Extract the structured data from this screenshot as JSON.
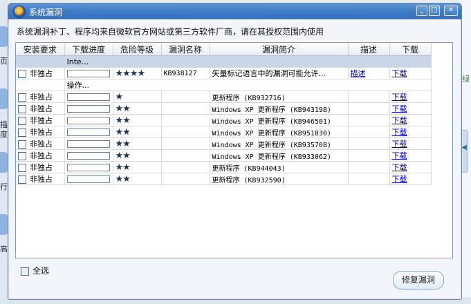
{
  "dialog": {
    "title": "系统漏洞",
    "notice": "系统漏洞补丁、程序均来自微软官方网站或第三方软件厂商，请在其授权范围内使用",
    "minimize_glyph": "_",
    "maximize_glyph": "□",
    "close_glyph": "✕"
  },
  "table": {
    "headers": [
      "安装要求",
      "下载进度",
      "危险等级",
      "漏洞名称",
      "漏洞简介",
      "描述",
      "下载"
    ],
    "groups": [
      {
        "label": "Inte...",
        "rows": [
          {
            "req": "非独占",
            "progress": 0,
            "stars": "★★★★",
            "name": "KB938127",
            "intro": "矢量标记语言中的漏洞可能允许...",
            "desc": "描述",
            "download": "下载"
          }
        ]
      },
      {
        "label": "操作...",
        "rows": [
          {
            "req": "非独占",
            "progress": 0,
            "stars": "★",
            "name": "",
            "intro": "更新程序 (KB932716)",
            "desc": "",
            "download": "下载"
          },
          {
            "req": "非独占",
            "progress": 0,
            "stars": "★★",
            "name": "",
            "intro": "Windows XP 更新程序 (KB943198)",
            "desc": "",
            "download": "下载"
          },
          {
            "req": "非独占",
            "progress": 0,
            "stars": "★★",
            "name": "",
            "intro": "Windows XP 更新程序 (KB946501)",
            "desc": "",
            "download": "下载"
          },
          {
            "req": "非独占",
            "progress": 0,
            "stars": "★★",
            "name": "",
            "intro": "Windows XP 更新程序 (KB951830)",
            "desc": "",
            "download": "下载"
          },
          {
            "req": "非独占",
            "progress": 0,
            "stars": "★★",
            "name": "",
            "intro": "Windows XP 更新程序 (KB935708)",
            "desc": "",
            "download": "下载"
          },
          {
            "req": "非独占",
            "progress": 0,
            "stars": "★★",
            "name": "",
            "intro": "Windows XP 更新程序 (KB933062)",
            "desc": "",
            "download": "下载"
          },
          {
            "req": "非独占",
            "progress": 0,
            "stars": "★★",
            "name": "",
            "intro": "更新程序 (KB944043)",
            "desc": "",
            "download": "下载"
          },
          {
            "req": "非独占",
            "progress": 0,
            "stars": "★★",
            "name": "",
            "intro": "更新程序 (KB932590)",
            "desc": "",
            "download": "下载"
          }
        ]
      }
    ]
  },
  "footer": {
    "select_all": "全选",
    "repair_button": "修复漏洞"
  },
  "background": {
    "left_texts": [
      "页",
      "描",
      "度",
      "行",
      "高"
    ],
    "right_text": "绿"
  },
  "colors": {
    "titlebar": "#3d78c2",
    "link": "#0000cc",
    "group_highlight": "#c9d6e8"
  }
}
